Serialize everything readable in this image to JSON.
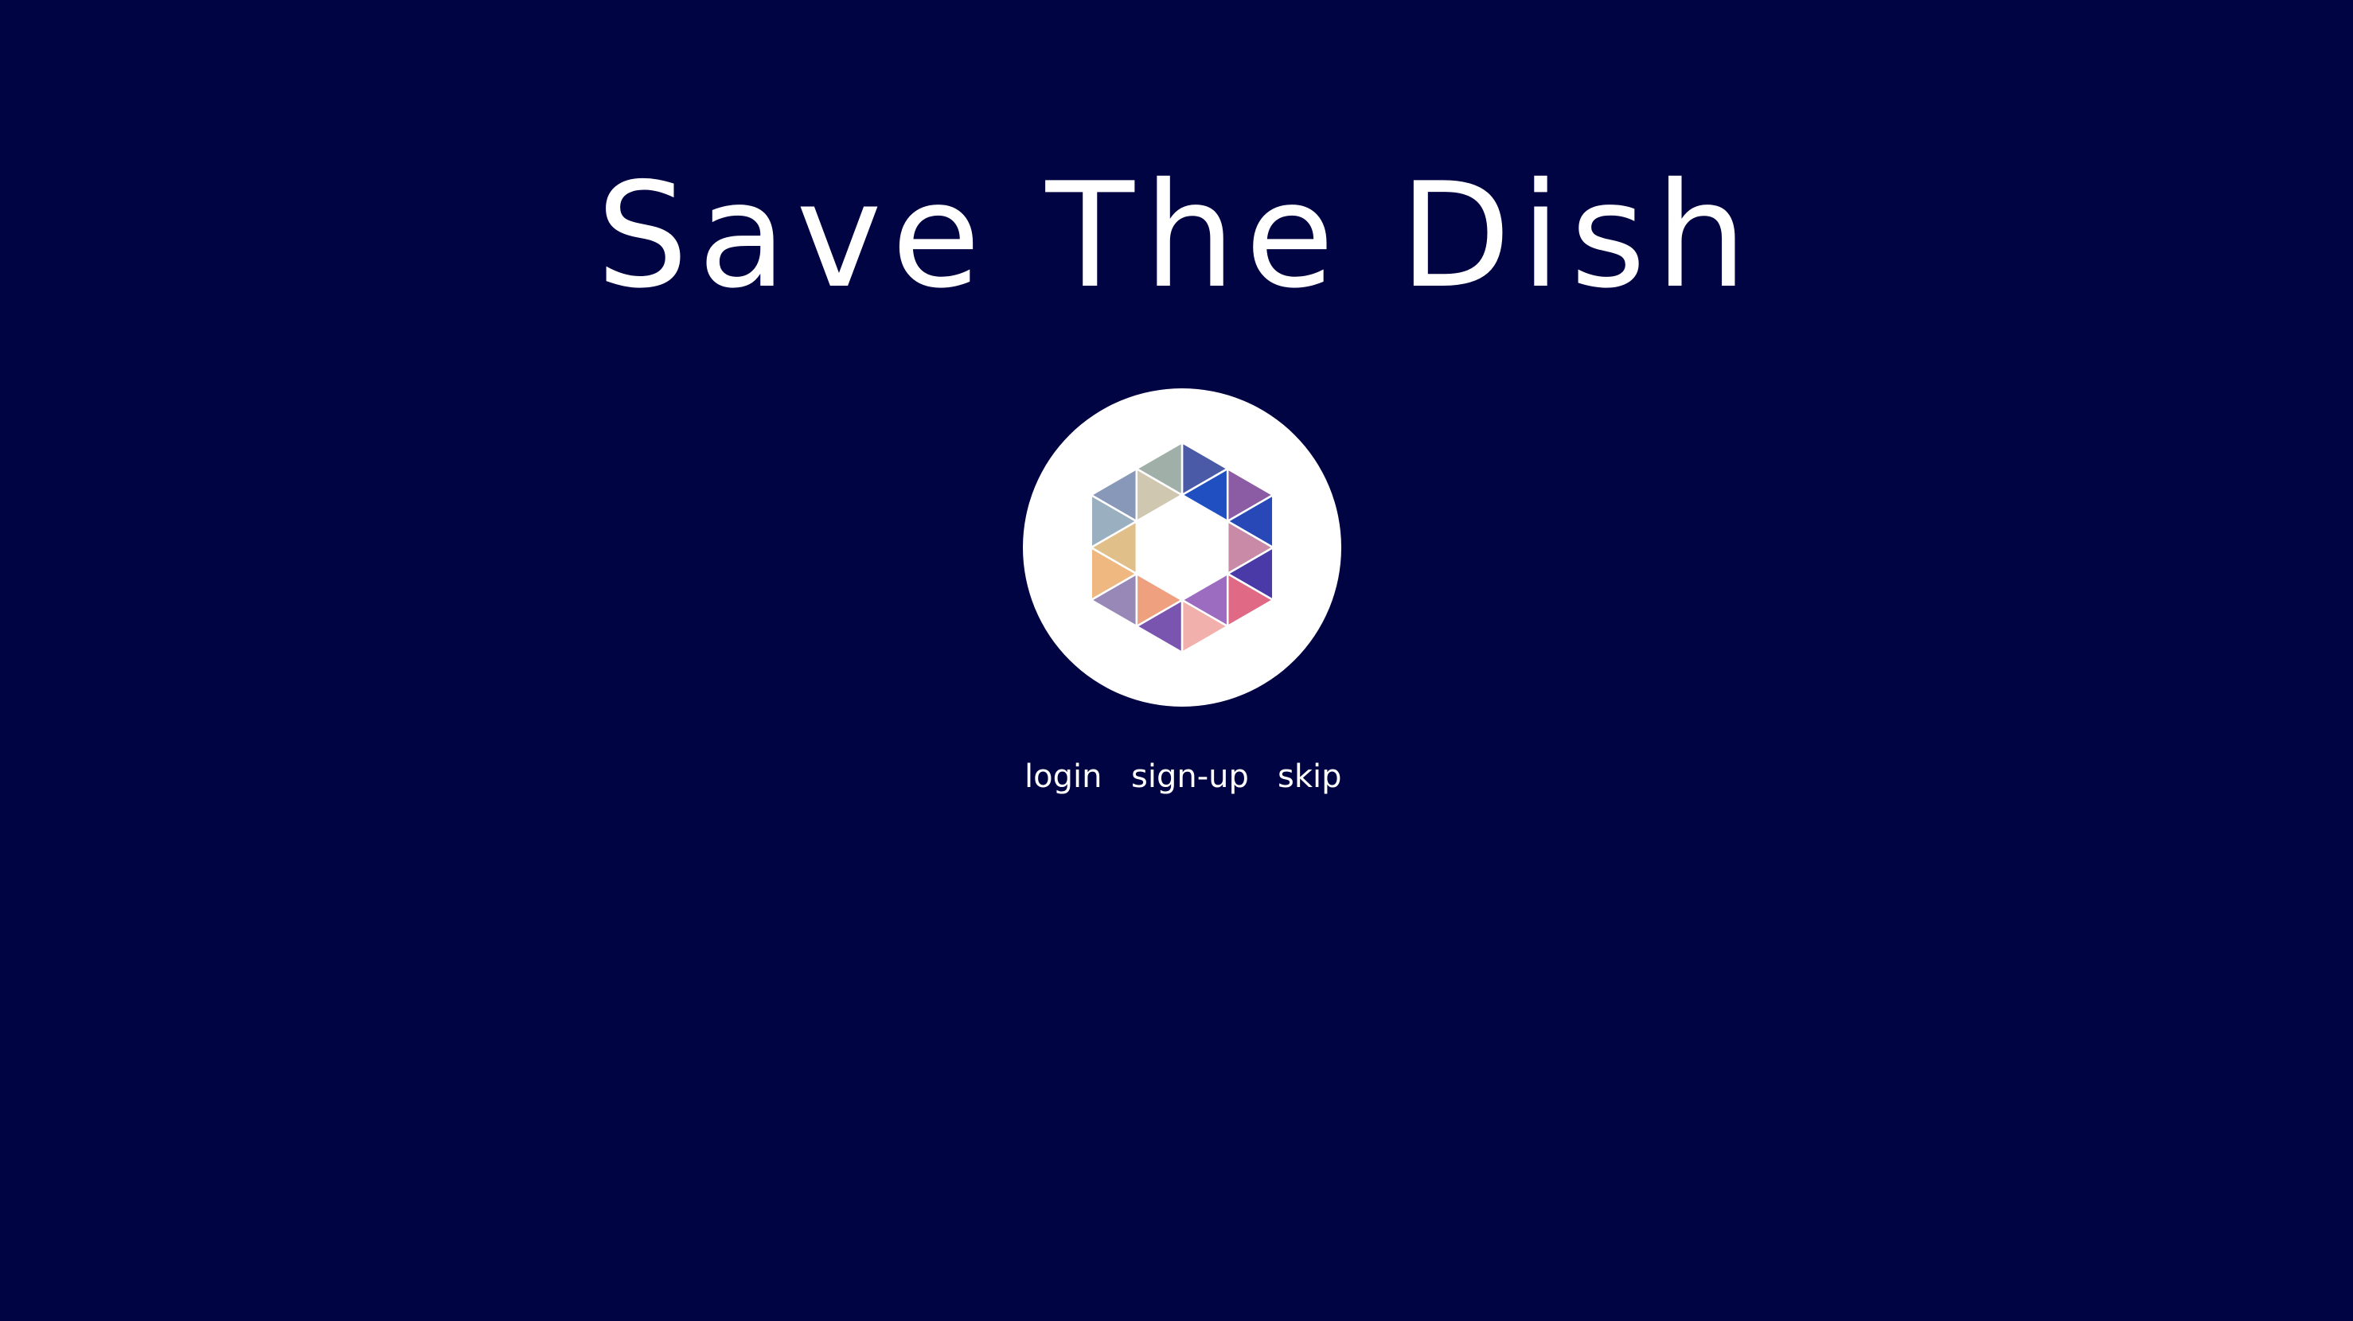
{
  "app": {
    "title": "Save The Dish",
    "background_color": "#000442",
    "text_color": "#ffffff"
  },
  "logo": {
    "icon": "hexagon-logo-icon",
    "circle_color": "#ffffff",
    "line_color": "#ffffff",
    "segment_colors": [
      "#4b5aa6",
      "#1f4fc0",
      "#8b5ba3",
      "#2848b8",
      "#c98aa8",
      "#4a3aa8",
      "#e06a85",
      "#9b6cc0",
      "#f2b0ad",
      "#7a55b0",
      "#eea07f",
      "#9888b8",
      "#efb880",
      "#e0c088",
      "#9ab0c0",
      "#8898b8",
      "#cfc7b0",
      "#a0b0a8"
    ]
  },
  "nav": {
    "login": "login",
    "signup": "sign-up",
    "skip": "skip"
  }
}
